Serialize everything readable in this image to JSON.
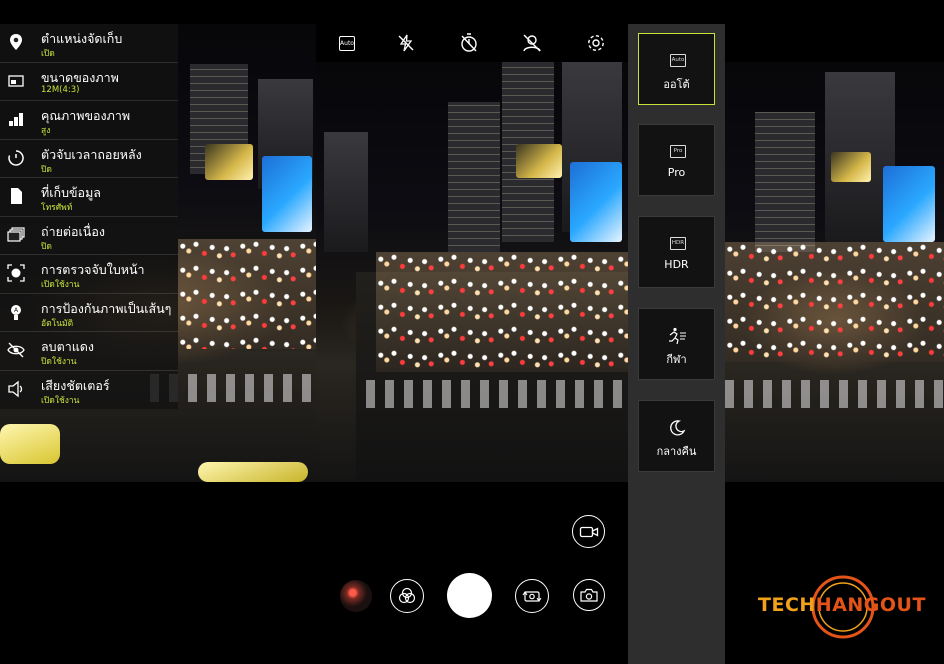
{
  "top_toolbar": {
    "auto_label": "Auto",
    "icons": [
      "auto-icon",
      "flash-off-icon",
      "timer-icon",
      "beauty-off-icon",
      "settings-gear-icon"
    ]
  },
  "settings_menu": {
    "items": [
      {
        "label": "ตำแหน่งจัดเก็บ",
        "value": "เปิด",
        "icon": "location-pin-icon"
      },
      {
        "label": "ขนาดของภาพ",
        "value": "12M(4:3)",
        "icon": "image-size-icon"
      },
      {
        "label": "คุณภาพของภาพ",
        "value": "สูง",
        "icon": "image-quality-icon"
      },
      {
        "label": "ตัวจับเวลาถอยหลัง",
        "value": "ปิด",
        "icon": "countdown-timer-icon"
      },
      {
        "label": "ที่เก็บข้อมูล",
        "value": "โทรศัพท์",
        "icon": "storage-icon"
      },
      {
        "label": "ถ่ายต่อเนื่อง",
        "value": "ปิด",
        "icon": "burst-icon"
      },
      {
        "label": "การตรวจจับใบหน้า",
        "value": "เปิดใช้งาน",
        "icon": "face-detect-icon"
      },
      {
        "label": "การป้องกันภาพเป็นเส้นๆ",
        "value": "อัตโนมัติ",
        "icon": "anti-banding-icon"
      },
      {
        "label": "ลบตาแดง",
        "value": "ปิดใช้งาน",
        "icon": "red-eye-icon"
      },
      {
        "label": "เสียงชัตเตอร์",
        "value": "เปิดใช้งาน",
        "icon": "shutter-sound-icon"
      }
    ]
  },
  "modes": [
    {
      "label": "ออโต้",
      "badge": "Auto",
      "selected": true
    },
    {
      "label": "Pro",
      "badge": "Pro",
      "selected": false
    },
    {
      "label": "HDR",
      "badge": "HDR",
      "selected": false
    },
    {
      "label": "กีฬา",
      "badge": "",
      "icon": "sport-runner-icon",
      "selected": false
    },
    {
      "label": "กลางคืน",
      "badge": "",
      "icon": "night-moon-icon",
      "selected": false
    }
  ],
  "bottom_controls": {
    "icons": [
      "gallery-thumbnail",
      "filters-icon",
      "shutter-button",
      "switch-camera-icon",
      "camera-mode-icon",
      "video-record-icon"
    ]
  },
  "logo": {
    "part1": "TECH",
    "part2": "HANGOUT"
  },
  "colors": {
    "accent": "#c7e33a",
    "panel": "#2e2e2e",
    "logo_orange": "#f2a21a",
    "logo_red": "#e45418"
  }
}
